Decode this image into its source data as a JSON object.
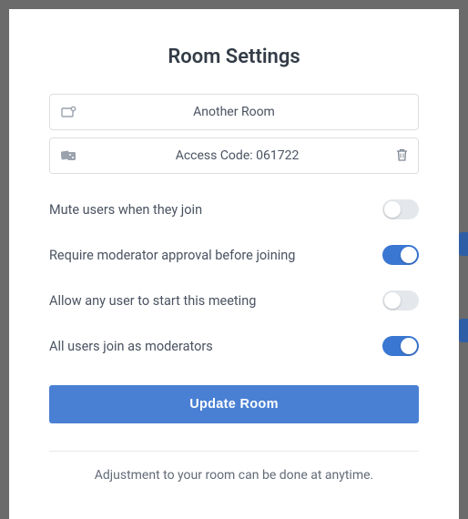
{
  "title": "Room Settings",
  "room_name": "Another Room",
  "access_code": {
    "label": "Access Code: 061722"
  },
  "toggles": [
    {
      "label": "Mute users when they join",
      "on": false
    },
    {
      "label": "Require moderator approval before joining",
      "on": true
    },
    {
      "label": "Allow any user to start this meeting",
      "on": false
    },
    {
      "label": "All users join as moderators",
      "on": true
    }
  ],
  "update_label": "Update Room",
  "footer": "Adjustment to your room can be done at anytime."
}
